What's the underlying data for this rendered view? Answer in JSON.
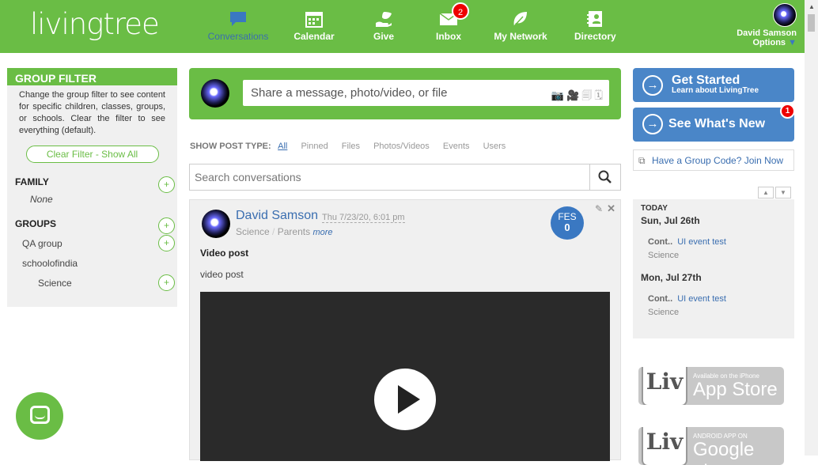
{
  "header": {
    "logo": "livingtree",
    "nav": [
      {
        "label": "Conversations",
        "icon": "speech-bubble-icon"
      },
      {
        "label": "Calendar",
        "icon": "calendar-icon"
      },
      {
        "label": "Give",
        "icon": "hand-leaf-icon"
      },
      {
        "label": "Inbox",
        "icon": "envelope-icon",
        "badge": "2"
      },
      {
        "label": "My Network",
        "icon": "leaf-icon"
      },
      {
        "label": "Directory",
        "icon": "contact-card-icon"
      }
    ],
    "user": {
      "name": "David Samson",
      "options": "Options"
    }
  },
  "group_filter": {
    "title": "GROUP FILTER",
    "description": "Change the group filter to see content for specific children, classes, groups, or schools. Clear the filter to see everything (default).",
    "clear_button": "Clear Filter - Show All",
    "family_label": "FAMILY",
    "family_value": "None",
    "groups_label": "GROUPS",
    "groups": [
      "QA group",
      "schoolofindia",
      "Science"
    ]
  },
  "share": {
    "placeholder": "Share a message, photo/video, or file"
  },
  "post_types": {
    "label": "SHOW POST TYPE:",
    "types": [
      "All",
      "Pinned",
      "Files",
      "Photos/Videos",
      "Events",
      "Users"
    ]
  },
  "search": {
    "placeholder": "Search conversations"
  },
  "post": {
    "author": "David Samson",
    "date": "Thu 7/23/20, 6:01 pm",
    "tag1": "Science",
    "tag2": "Parents",
    "more": "more",
    "fes_label": "FES",
    "fes_count": "0",
    "title": "Video post",
    "body": "video post"
  },
  "right": {
    "get_started": "Get Started",
    "get_started_sub": "Learn about LivingTree",
    "whats_new": "See What's New",
    "whats_new_badge": "1",
    "group_code": "Have a Group Code? Join Now",
    "calendar": {
      "today": "TODAY",
      "days": [
        {
          "date": "Sun, Jul 26th",
          "prefix": "Cont..",
          "event": "UI event test",
          "group": "Science"
        },
        {
          "date": "Mon, Jul 27th",
          "prefix": "Cont..",
          "event": "UI event test",
          "group": "Science"
        }
      ]
    },
    "app_store": {
      "small": "Available on the iPhone",
      "big": "App Store",
      "logo": "Liv"
    },
    "google_play": {
      "small": "ANDROID APP ON",
      "big": "Google play",
      "logo": "Liv"
    }
  }
}
